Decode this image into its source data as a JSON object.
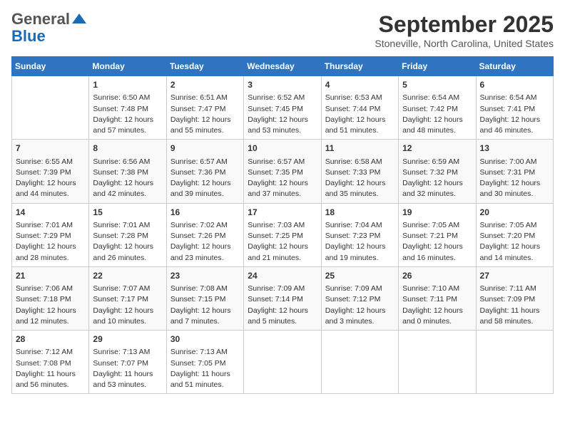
{
  "logo": {
    "general": "General",
    "blue": "Blue"
  },
  "header": {
    "month": "September 2025",
    "location": "Stoneville, North Carolina, United States"
  },
  "days_of_week": [
    "Sunday",
    "Monday",
    "Tuesday",
    "Wednesday",
    "Thursday",
    "Friday",
    "Saturday"
  ],
  "weeks": [
    [
      {
        "day": "",
        "info": ""
      },
      {
        "day": "1",
        "info": "Sunrise: 6:50 AM\nSunset: 7:48 PM\nDaylight: 12 hours\nand 57 minutes."
      },
      {
        "day": "2",
        "info": "Sunrise: 6:51 AM\nSunset: 7:47 PM\nDaylight: 12 hours\nand 55 minutes."
      },
      {
        "day": "3",
        "info": "Sunrise: 6:52 AM\nSunset: 7:45 PM\nDaylight: 12 hours\nand 53 minutes."
      },
      {
        "day": "4",
        "info": "Sunrise: 6:53 AM\nSunset: 7:44 PM\nDaylight: 12 hours\nand 51 minutes."
      },
      {
        "day": "5",
        "info": "Sunrise: 6:54 AM\nSunset: 7:42 PM\nDaylight: 12 hours\nand 48 minutes."
      },
      {
        "day": "6",
        "info": "Sunrise: 6:54 AM\nSunset: 7:41 PM\nDaylight: 12 hours\nand 46 minutes."
      }
    ],
    [
      {
        "day": "7",
        "info": "Sunrise: 6:55 AM\nSunset: 7:39 PM\nDaylight: 12 hours\nand 44 minutes."
      },
      {
        "day": "8",
        "info": "Sunrise: 6:56 AM\nSunset: 7:38 PM\nDaylight: 12 hours\nand 42 minutes."
      },
      {
        "day": "9",
        "info": "Sunrise: 6:57 AM\nSunset: 7:36 PM\nDaylight: 12 hours\nand 39 minutes."
      },
      {
        "day": "10",
        "info": "Sunrise: 6:57 AM\nSunset: 7:35 PM\nDaylight: 12 hours\nand 37 minutes."
      },
      {
        "day": "11",
        "info": "Sunrise: 6:58 AM\nSunset: 7:33 PM\nDaylight: 12 hours\nand 35 minutes."
      },
      {
        "day": "12",
        "info": "Sunrise: 6:59 AM\nSunset: 7:32 PM\nDaylight: 12 hours\nand 32 minutes."
      },
      {
        "day": "13",
        "info": "Sunrise: 7:00 AM\nSunset: 7:31 PM\nDaylight: 12 hours\nand 30 minutes."
      }
    ],
    [
      {
        "day": "14",
        "info": "Sunrise: 7:01 AM\nSunset: 7:29 PM\nDaylight: 12 hours\nand 28 minutes."
      },
      {
        "day": "15",
        "info": "Sunrise: 7:01 AM\nSunset: 7:28 PM\nDaylight: 12 hours\nand 26 minutes."
      },
      {
        "day": "16",
        "info": "Sunrise: 7:02 AM\nSunset: 7:26 PM\nDaylight: 12 hours\nand 23 minutes."
      },
      {
        "day": "17",
        "info": "Sunrise: 7:03 AM\nSunset: 7:25 PM\nDaylight: 12 hours\nand 21 minutes."
      },
      {
        "day": "18",
        "info": "Sunrise: 7:04 AM\nSunset: 7:23 PM\nDaylight: 12 hours\nand 19 minutes."
      },
      {
        "day": "19",
        "info": "Sunrise: 7:05 AM\nSunset: 7:21 PM\nDaylight: 12 hours\nand 16 minutes."
      },
      {
        "day": "20",
        "info": "Sunrise: 7:05 AM\nSunset: 7:20 PM\nDaylight: 12 hours\nand 14 minutes."
      }
    ],
    [
      {
        "day": "21",
        "info": "Sunrise: 7:06 AM\nSunset: 7:18 PM\nDaylight: 12 hours\nand 12 minutes."
      },
      {
        "day": "22",
        "info": "Sunrise: 7:07 AM\nSunset: 7:17 PM\nDaylight: 12 hours\nand 10 minutes."
      },
      {
        "day": "23",
        "info": "Sunrise: 7:08 AM\nSunset: 7:15 PM\nDaylight: 12 hours\nand 7 minutes."
      },
      {
        "day": "24",
        "info": "Sunrise: 7:09 AM\nSunset: 7:14 PM\nDaylight: 12 hours\nand 5 minutes."
      },
      {
        "day": "25",
        "info": "Sunrise: 7:09 AM\nSunset: 7:12 PM\nDaylight: 12 hours\nand 3 minutes."
      },
      {
        "day": "26",
        "info": "Sunrise: 7:10 AM\nSunset: 7:11 PM\nDaylight: 12 hours\nand 0 minutes."
      },
      {
        "day": "27",
        "info": "Sunrise: 7:11 AM\nSunset: 7:09 PM\nDaylight: 11 hours\nand 58 minutes."
      }
    ],
    [
      {
        "day": "28",
        "info": "Sunrise: 7:12 AM\nSunset: 7:08 PM\nDaylight: 11 hours\nand 56 minutes."
      },
      {
        "day": "29",
        "info": "Sunrise: 7:13 AM\nSunset: 7:07 PM\nDaylight: 11 hours\nand 53 minutes."
      },
      {
        "day": "30",
        "info": "Sunrise: 7:13 AM\nSunset: 7:05 PM\nDaylight: 11 hours\nand 51 minutes."
      },
      {
        "day": "",
        "info": ""
      },
      {
        "day": "",
        "info": ""
      },
      {
        "day": "",
        "info": ""
      },
      {
        "day": "",
        "info": ""
      }
    ]
  ]
}
